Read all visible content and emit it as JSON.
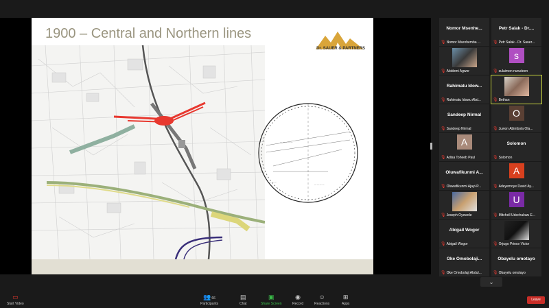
{
  "slide": {
    "title": "1900 – Central and Northern lines",
    "logo_text": "Dr. SAUER & PARTNERS"
  },
  "participants": [
    {
      "big_name": "Nomor Msenhe...",
      "label": "Nomor Msenhemba ..."
    },
    {
      "big_name": "Petr Salak - Dr....",
      "label": "Petr Salak - Dr. Sauer..."
    },
    {
      "label": "Abidemi Agwor",
      "photo": true
    },
    {
      "avatar_letter": "s",
      "avatar_color": "#b04fc2",
      "label": "sulaimon nurudeen"
    },
    {
      "big_name": "Rahimatu Idow...",
      "label": "Rahimatu Idowu Abd..."
    },
    {
      "label": "Bethan",
      "photo": true,
      "highlight": true
    },
    {
      "big_name": "Sandeep Nirmal",
      "label": "Sandeep Nirmal"
    },
    {
      "avatar_letter": "O",
      "avatar_color": "#5a4034",
      "label": "Juwon Abimbola Ola..."
    },
    {
      "avatar_letter": "A",
      "avatar_color": "#a98a7a",
      "label": "Adisa Toheeb Paul"
    },
    {
      "big_name": "Solomon",
      "label": "Solomon"
    },
    {
      "big_name": "Oluwafikunmi A...",
      "label": "Oluwafikunmi Ajayi-P..."
    },
    {
      "avatar_letter": "A",
      "avatar_color": "#d8401e",
      "label": "Adeyemoye David Ay..."
    },
    {
      "label": "Joseph Oyewole",
      "photo": true
    },
    {
      "avatar_letter": "U",
      "avatar_color": "#7a2aa6",
      "label": "Mitchell Udechukwu E..."
    },
    {
      "big_name": "Abigail Wogor",
      "label": "Abigail Wogor"
    },
    {
      "label": "Orjugo Prince Victor",
      "photo": true
    },
    {
      "big_name": "Oke Omobolaji...",
      "label": "Oke Omobolaji Abdul..."
    },
    {
      "big_name": "Obayelu omotayo",
      "label": "Obayelu omotayo"
    }
  ],
  "toolbar": {
    "start_video": "Start Video",
    "participants": "Participants",
    "participants_count": "66",
    "chat": "Chat",
    "share_screen": "Share Screen",
    "record": "Record",
    "reactions": "Reactions",
    "apps": "Apps",
    "leave": "Leave"
  },
  "colors": {
    "accent_green": "#3bbf4a",
    "leave_red": "#c92e28",
    "title_color": "#9a9580"
  }
}
